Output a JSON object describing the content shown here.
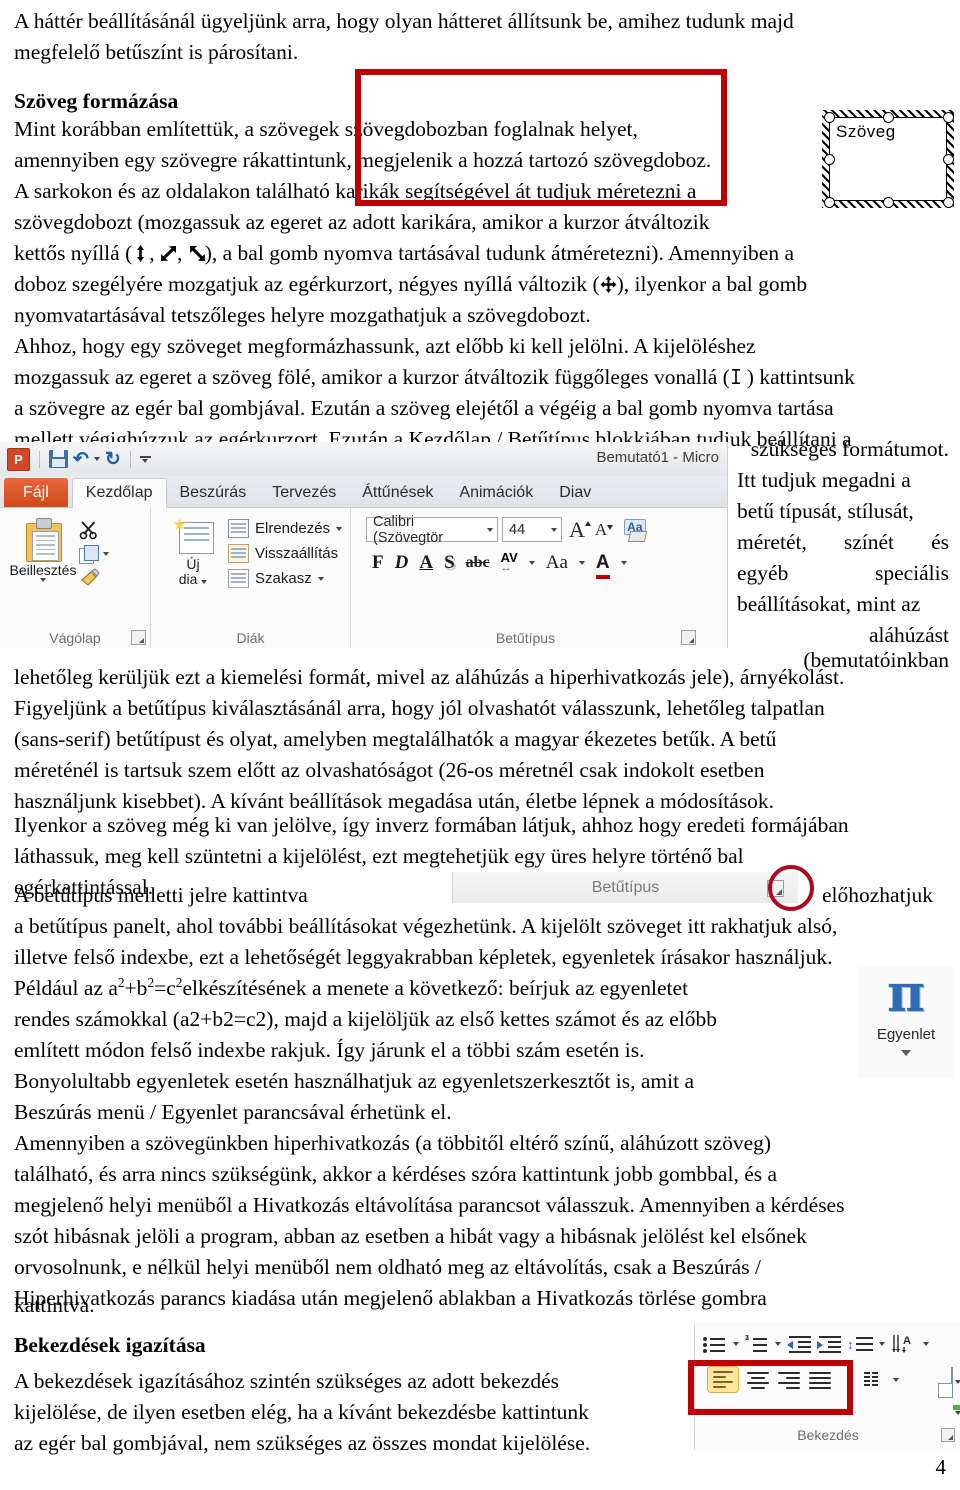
{
  "document": {
    "page_number": "4",
    "paragraphs": {
      "intro_line1": "A háttér beállításánál ügyeljünk arra, hogy olyan hátteret állítsunk be, amihez tudunk majd",
      "intro_line2": "megfelelő betűszínt is párosítani.",
      "heading_text_formatting": "Szöveg formázása",
      "p1_line1": "Mint korábban említettük, a szövegek szövegdobozban foglalnak helyet,",
      "p1_line2": "amennyiben egy szövegre rákattintunk, megjelenik a hozzá tartozó szövegdoboz.",
      "p1_line3": "A sarkokon és az oldalakon található karikák segítségével át tudjuk méretezni a",
      "p1_line4": "szövegdobozt (mozgassuk az egeret az adott karikára, amikor a kurzor átváltozik",
      "p1_line5_a": "kettős nyíllá (",
      "p1_line5_b": ", ",
      "p1_line5_c": ", ",
      "p1_line5_d": "), a bal gomb nyomva tartásával tudunk átméretezni). Amennyiben a",
      "p1_line6_a": "doboz szegélyére mozgatjuk az egérkurzort, négyes nyíllá változik (",
      "p1_line6_b": "), ilyenkor a bal gomb",
      "p1_line7": "nyomvatartásával tetszőleges helyre mozgathatjuk a szövegdobozt.",
      "p1_line8": "Ahhoz, hogy egy szöveget megformázhassunk, azt előbb ki kell jelölni. A kijelöléshez",
      "p1_line9_a": "mozgassuk az egeret a szöveg fölé, amikor a kurzor átváltozik függőleges vonallá (",
      "p1_line9_b": ") kattintsunk",
      "p1_line10": "a szövegre az egér bal gombjával. Ezután a szöveg elejétől a végéig a bal gomb nyomva tartása",
      "p1_line11": "mellett végighúzzuk az egérkurzort. Ezután a Kezdőlap / Betűtípus blokkjában tudjuk beállítani a",
      "right_col_1": "szükséges formátumot.",
      "right_col_2": "Itt tudjuk megadni a",
      "right_col_3": "betű típusát, stílusát,",
      "right_col_4_a": "méretét,",
      "right_col_4_b": "színét",
      "right_col_4_c": "és",
      "right_col_5_a": "egyéb",
      "right_col_5_b": "speciális",
      "right_col_6": "beállításokat, mint az",
      "right_col_7": "aláhúzást",
      "right_col_8": "(bemutatóinkban",
      "p2_line1": "lehetőleg kerüljük ezt a kiemelési formát, mivel az aláhúzás a hiperhivatkozás jele), árnyékolást.",
      "p2_line2": "Figyeljünk a betűtípus kiválasztásánál arra, hogy jól olvashatót válasszunk, lehetőleg talpatlan",
      "p2_line3": "(sans-serif) betűtípust és olyat, amelyben megtalálhatók a magyar ékezetes betűk. A betű",
      "p2_line4": "méreténél is tartsuk szem előtt az olvashatóságot (26-os méretnél csak indokolt esetben",
      "p2_line5": "használjunk kisebbet). A kívánt beállítások megadása után, életbe lépnek a módosítások.",
      "p3_line1": "Ilyenkor a szöveg még ki van jelölve, így inverz formában látjuk, ahhoz hogy eredeti formájában",
      "p3_line2": "láthassuk, meg kell szüntetni a kijelölést, ezt megtehetjük egy üres helyre történő bal",
      "p3_line3": "egérkattintással.",
      "p3_line4_a": "A betűtípus melletti jelre kattintva",
      "p3_line4_b": "előhozhatjuk",
      "p3_line5": "a betűtípus panelt, ahol további beállításokat végezhetünk. A kijelölt szöveget itt rakhatjuk alsó,",
      "p3_line6": "illetve felső indexbe, ezt a lehetőségét leggyakrabban képletek, egyenletek írásakor használjuk.",
      "p4_line1_a": "Például az a",
      "p4_line1_sup1": "2",
      "p4_line1_b": "+b",
      "p4_line1_sup2": "2",
      "p4_line1_c": "=c",
      "p4_line1_sup3": "2",
      "p4_line1_d": " elkészítésének a menete a következő: beírjuk az egyenletet",
      "p4_line2": "rendes számokkal (a2+b2=c2), majd a kijelöljük az első kettes számot és az előbb",
      "p4_line3": "említett módon felső indexbe rakjuk. Így járunk el a többi szám esetén is.",
      "p4_line4": "Bonyolultabb egyenletek esetén használhatjuk az egyenletszerkesztőt is, amit a",
      "p4_line5": "Beszúrás menü / Egyenlet parancsával érhetünk el.",
      "p5_line1": "Amennyiben a szövegünkben hiperhivatkozás (a többitől eltérő színű, aláhúzott szöveg)",
      "p5_line2": "található, és arra nincs szükségünk, akkor a kérdéses szóra kattintunk jobb gombbal, és a",
      "p5_line3": "megjelenő helyi menüből a Hivatkozás eltávolítása parancsot válasszuk. Amennyiben a kérdéses",
      "p5_line4": "szót hibásnak jelöli a program, abban az esetben a hibát vagy a hibásnak jelölést kel elsőnek",
      "p5_line5": "orvosolnunk, e nélkül helyi menüből nem oldható meg az eltávolítás, csak a Beszúrás /",
      "p5_line6": "Hiperhivatkozás parancs kiadása után megjelenő ablakban a Hivatkozás törlése gombra",
      "p5_line7": "kattintva.",
      "heading_paragraph_align": "Bekezdések igazítása",
      "p6_line1": "A bekezdések igazításához szintén szükséges az adott bekezdés",
      "p6_line2": "kijelölése, de ilyen esetben elég, ha a kívánt bekezdésbe kattintunk",
      "p6_line3": "az egér bal gombjával, nem szükséges az összes mondat kijelölése."
    }
  },
  "textbox_graphic": {
    "label": "Szöveg"
  },
  "powerpoint_ribbon": {
    "app_logo": "P",
    "window_title": "Bemutató1 - Micro",
    "tabs": [
      {
        "label": "Fájl"
      },
      {
        "label": "Kezdőlap"
      },
      {
        "label": "Beszúrás"
      },
      {
        "label": "Tervezés"
      },
      {
        "label": "Áttűnések"
      },
      {
        "label": "Animációk"
      },
      {
        "label": "Diav"
      }
    ],
    "groups": {
      "clipboard": {
        "label": "Vágólap",
        "paste_label": "Beillesztés"
      },
      "slides": {
        "label": "Diák",
        "new_slide_label": "Új",
        "new_slide_label2": "dia",
        "items": [
          {
            "label": "Elrendezés"
          },
          {
            "label": "Visszaállítás"
          },
          {
            "label": "Szakasz"
          }
        ]
      },
      "font": {
        "label": "Betűtípus",
        "font_name": "Calibri (Szövegtör",
        "font_size": "44",
        "buttons": {
          "bold": "F",
          "italic": "D",
          "underline": "A",
          "shadow": "S",
          "strikethrough": "abc",
          "spacing": "AV",
          "case": "Aa",
          "color": "A"
        }
      }
    },
    "highlight_color": "#c00000"
  },
  "inline_font_button": {
    "label": "Betűtípus",
    "circle_color": "#a80d25"
  },
  "equation_button": {
    "symbol": "π",
    "label": "Egyenlet"
  },
  "paragraph_ribbon": {
    "label": "Bekezdés",
    "highlight_color": "#c00000",
    "selected_align": "align-left"
  }
}
